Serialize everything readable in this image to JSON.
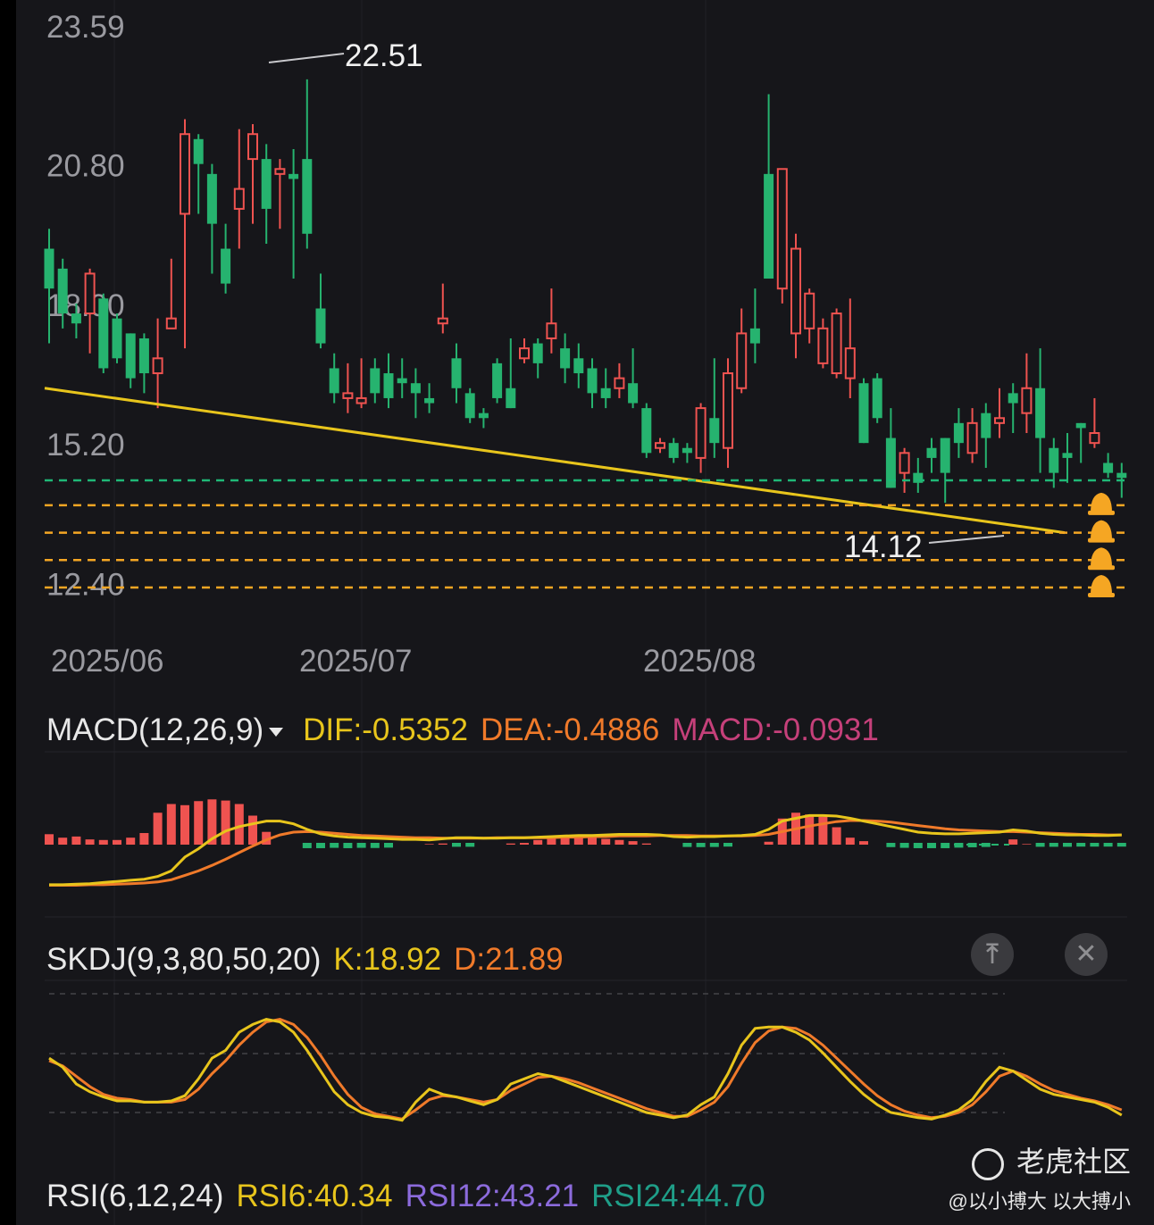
{
  "chart_data": [
    {
      "type": "candlestick",
      "price_ticks": [
        "23.59",
        "20.80",
        "18.00",
        "15.20",
        "12.40"
      ],
      "date_ticks": [
        "2025/06",
        "2025/07",
        "2025/08"
      ],
      "annotations": {
        "high": "22.51",
        "low": "14.12"
      },
      "colors": {
        "up": "#ef5350",
        "down": "#26b36f",
        "trendline": "#e8c51c",
        "support": "#1fb877",
        "alert": "#f5a623"
      },
      "candles": [
        [
          19.1,
          18.3,
          19.5,
          17.2
        ],
        [
          18.7,
          17.8,
          18.9,
          17.5
        ],
        [
          17.8,
          17.6,
          18.0,
          17.3
        ],
        [
          17.8,
          18.6,
          18.7,
          17.0
        ],
        [
          18.1,
          16.7,
          18.2,
          16.6
        ],
        [
          17.7,
          16.9,
          17.8,
          16.8
        ],
        [
          17.4,
          16.5,
          17.4,
          16.3
        ],
        [
          17.3,
          16.6,
          17.4,
          16.2
        ],
        [
          16.6,
          16.9,
          17.7,
          15.9
        ],
        [
          17.5,
          17.7,
          18.9,
          17.5
        ],
        [
          19.8,
          21.4,
          21.7,
          17.1
        ],
        [
          21.3,
          20.8,
          21.4,
          19.8
        ],
        [
          20.6,
          19.6,
          20.8,
          18.6
        ],
        [
          19.1,
          18.4,
          19.6,
          18.2
        ],
        [
          19.9,
          20.3,
          21.5,
          19.1
        ],
        [
          20.9,
          21.4,
          21.6,
          19.6
        ],
        [
          20.9,
          19.9,
          21.2,
          19.2
        ],
        [
          20.6,
          20.7,
          20.9,
          19.5
        ],
        [
          20.6,
          20.5,
          21.1,
          18.5
        ],
        [
          20.9,
          19.4,
          22.5,
          19.1
        ],
        [
          17.9,
          17.2,
          18.6,
          17.1
        ],
        [
          16.7,
          16.2,
          17.0,
          16.0
        ],
        [
          16.1,
          16.2,
          16.8,
          15.8
        ],
        [
          16.0,
          16.1,
          16.9,
          15.9
        ],
        [
          16.7,
          16.2,
          16.9,
          16.0
        ],
        [
          16.6,
          16.1,
          17.0,
          15.9
        ],
        [
          16.5,
          16.4,
          16.9,
          16.1
        ],
        [
          16.4,
          16.2,
          16.7,
          15.7
        ],
        [
          16.1,
          16.0,
          16.4,
          15.8
        ],
        [
          17.6,
          17.7,
          18.4,
          17.4
        ],
        [
          16.9,
          16.3,
          17.2,
          16.0
        ],
        [
          16.2,
          15.7,
          16.3,
          15.6
        ],
        [
          15.8,
          15.7,
          15.9,
          15.5
        ],
        [
          16.8,
          16.1,
          16.9,
          16.0
        ],
        [
          16.3,
          15.9,
          17.3,
          15.9
        ],
        [
          16.9,
          17.1,
          17.3,
          16.8
        ],
        [
          17.2,
          16.8,
          17.3,
          16.5
        ],
        [
          17.3,
          17.6,
          18.3,
          17.0
        ],
        [
          17.1,
          16.7,
          17.4,
          16.4
        ],
        [
          16.9,
          16.6,
          17.2,
          16.3
        ],
        [
          16.7,
          16.2,
          16.9,
          15.9
        ],
        [
          16.3,
          16.1,
          16.7,
          15.9
        ],
        [
          16.3,
          16.5,
          16.8,
          16.1
        ],
        [
          16.4,
          16.0,
          17.1,
          15.9
        ],
        [
          15.9,
          15.0,
          16.0,
          14.9
        ],
        [
          15.1,
          15.2,
          15.3,
          15.0
        ],
        [
          15.2,
          14.9,
          15.3,
          14.8
        ],
        [
          15.1,
          15.0,
          15.2,
          14.8
        ],
        [
          14.9,
          15.9,
          16.0,
          14.6
        ],
        [
          15.7,
          15.2,
          16.9,
          14.9
        ],
        [
          15.1,
          16.6,
          16.9,
          14.7
        ],
        [
          16.3,
          17.4,
          17.9,
          16.2
        ],
        [
          17.5,
          17.2,
          18.3,
          16.8
        ],
        [
          20.6,
          18.5,
          22.2,
          18.5
        ],
        [
          18.3,
          20.7,
          20.7,
          18.0
        ],
        [
          17.4,
          19.1,
          19.4,
          16.9
        ],
        [
          17.5,
          18.2,
          18.3,
          17.2
        ],
        [
          16.8,
          17.5,
          17.7,
          16.7
        ],
        [
          16.6,
          17.8,
          17.9,
          16.5
        ],
        [
          16.5,
          17.1,
          18.1,
          16.1
        ],
        [
          16.4,
          15.2,
          16.5,
          15.2
        ],
        [
          16.5,
          15.7,
          16.6,
          15.6
        ],
        [
          15.3,
          14.3,
          15.9,
          14.3
        ],
        [
          14.6,
          15.0,
          15.1,
          14.2
        ],
        [
          14.6,
          14.4,
          14.9,
          14.2
        ],
        [
          15.1,
          14.9,
          15.3,
          14.6
        ],
        [
          15.3,
          14.6,
          15.3,
          14.0
        ],
        [
          15.6,
          15.2,
          15.9,
          14.9
        ],
        [
          15.0,
          15.6,
          15.9,
          14.8
        ],
        [
          15.8,
          15.3,
          16.0,
          14.7
        ],
        [
          15.6,
          15.7,
          16.3,
          15.3
        ],
        [
          16.2,
          16.0,
          16.4,
          15.4
        ],
        [
          15.8,
          16.3,
          17.0,
          15.4
        ],
        [
          16.3,
          15.3,
          17.1,
          14.6
        ],
        [
          15.1,
          14.6,
          15.3,
          14.3
        ],
        [
          15.0,
          14.9,
          15.4,
          14.4
        ],
        [
          15.6,
          15.5,
          15.6,
          14.8
        ],
        [
          15.2,
          15.4,
          16.1,
          15.1
        ],
        [
          14.8,
          14.6,
          15.0,
          14.5
        ],
        [
          14.6,
          14.5,
          14.8,
          14.1
        ]
      ],
      "trendline": [
        [
          0,
          16.3
        ],
        [
          73,
          13.4
        ]
      ],
      "support_lines": [
        14.45
      ],
      "alert_lines": [
        13.95,
        13.4,
        12.85,
        12.3
      ]
    },
    {
      "type": "bar+line",
      "indicator": "MACD",
      "dif": [
        -0.95,
        -0.95,
        -0.94,
        -0.93,
        -0.91,
        -0.89,
        -0.87,
        -0.85,
        -0.8,
        -0.7,
        -0.45,
        -0.3,
        -0.12,
        0.02,
        0.1,
        0.15,
        0.2,
        0.2,
        0.15,
        0.05,
        -0.03,
        -0.07,
        -0.09,
        -0.1,
        -0.11,
        -0.12,
        -0.13,
        -0.13,
        -0.14,
        -0.12,
        -0.1,
        -0.1,
        -0.11,
        -0.11,
        -0.1,
        -0.1,
        -0.09,
        -0.08,
        -0.07,
        -0.06,
        -0.06,
        -0.05,
        -0.04,
        -0.04,
        -0.04,
        -0.05,
        -0.08,
        -0.09,
        -0.08,
        -0.08,
        -0.07,
        -0.06,
        -0.04,
        0.05,
        0.2,
        0.25,
        0.3,
        0.3,
        0.29,
        0.25,
        0.2,
        0.15,
        0.1,
        0.05,
        0,
        -0.02,
        -0.03,
        -0.03,
        -0.02,
        -0.01,
        0.0,
        0.04,
        0.02,
        -0.02,
        -0.04,
        -0.05,
        -0.05,
        -0.06,
        -0.06,
        -0.05
      ],
      "dea": [
        -0.96,
        -0.96,
        -0.96,
        -0.95,
        -0.95,
        -0.94,
        -0.93,
        -0.92,
        -0.9,
        -0.86,
        -0.78,
        -0.7,
        -0.6,
        -0.49,
        -0.37,
        -0.25,
        -0.14,
        -0.05,
        0.0,
        0.01,
        0.0,
        -0.02,
        -0.04,
        -0.06,
        -0.07,
        -0.08,
        -0.09,
        -0.1,
        -0.1,
        -0.11,
        -0.11,
        -0.11,
        -0.11,
        -0.1,
        -0.1,
        -0.1,
        -0.1,
        -0.1,
        -0.09,
        -0.09,
        -0.08,
        -0.08,
        -0.07,
        -0.07,
        -0.07,
        -0.06,
        -0.06,
        -0.06,
        -0.07,
        -0.07,
        -0.07,
        -0.07,
        -0.06,
        -0.04,
        0.01,
        0.06,
        0.11,
        0.15,
        0.19,
        0.21,
        0.21,
        0.2,
        0.18,
        0.15,
        0.12,
        0.09,
        0.06,
        0.04,
        0.03,
        0.02,
        0.01,
        0.01,
        0.0,
        -0.01,
        -0.02,
        -0.03,
        -0.04,
        -0.04,
        -0.05,
        -0.05
      ],
      "hist": [
        0.18,
        0.12,
        0.14,
        0.09,
        0.08,
        0.08,
        0.12,
        0.2,
        0.55,
        0.7,
        0.68,
        0.75,
        0.78,
        0.76,
        0.7,
        0.5,
        0.22,
        0,
        0,
        -0.1,
        -0.1,
        -0.08,
        -0.1,
        -0.08,
        -0.09,
        -0.07,
        0.0,
        0.0,
        0.01,
        0.02,
        -0.02,
        -0.02,
        0.0,
        0.0,
        0.02,
        0.03,
        0.08,
        0.14,
        0.15,
        0.13,
        0.12,
        0.1,
        0.08,
        0.06,
        0.02,
        0.0,
        0.0,
        -0.03,
        -0.04,
        -0.03,
        -0.01,
        0.0,
        0.0,
        0.05,
        0.45,
        0.55,
        0.52,
        0.48,
        0.3,
        0.12,
        0.06,
        0.0,
        -0.04,
        -0.08,
        -0.1,
        -0.1,
        -0.1,
        -0.07,
        -0.05,
        -0.03,
        0.0,
        0.09,
        0.01,
        -0.02,
        -0.02,
        -0.02,
        -0.01,
        -0.01,
        -0.01,
        -0.01
      ],
      "labels": {
        "name": "MACD(12,26,9)",
        "dif": "DIF:-0.5352",
        "dea": "DEA:-0.4886",
        "macd": "MACD:-0.0931"
      },
      "colors": {
        "dif": "#e8c51c",
        "dea": "#f07a2a",
        "macd_label": "#c5407a",
        "up": "#ef5350",
        "down": "#26b36f"
      }
    },
    {
      "type": "line",
      "indicator": "SKDJ",
      "k": [
        62,
        55,
        42,
        36,
        32,
        29,
        29,
        28,
        28,
        29,
        33,
        46,
        62,
        68,
        82,
        88,
        92,
        90,
        82,
        68,
        52,
        36,
        26,
        20,
        17,
        16,
        14,
        28,
        38,
        34,
        32,
        29,
        26,
        30,
        42,
        46,
        50,
        48,
        44,
        40,
        36,
        32,
        28,
        24,
        20,
        18,
        16,
        18,
        26,
        32,
        50,
        72,
        85,
        86,
        86,
        82,
        76,
        66,
        55,
        44,
        34,
        26,
        20,
        18,
        16,
        15,
        18,
        22,
        30,
        44,
        55,
        52,
        45,
        38,
        34,
        32,
        30,
        28,
        24,
        18
      ],
      "d": [
        60,
        56,
        48,
        40,
        34,
        31,
        30,
        28,
        28,
        28,
        30,
        38,
        50,
        60,
        72,
        82,
        90,
        92,
        88,
        78,
        64,
        48,
        34,
        24,
        19,
        17,
        15,
        22,
        30,
        33,
        32,
        30,
        28,
        30,
        37,
        42,
        47,
        48,
        46,
        43,
        39,
        35,
        31,
        27,
        23,
        20,
        17,
        17,
        22,
        28,
        40,
        58,
        74,
        83,
        86,
        85,
        80,
        72,
        62,
        52,
        42,
        33,
        26,
        21,
        18,
        16,
        17,
        20,
        26,
        36,
        48,
        52,
        48,
        42,
        37,
        34,
        31,
        29,
        26,
        22
      ],
      "ylim": [
        0,
        100
      ],
      "labels": {
        "name": "SKDJ(9,3,80,50,20)",
        "k": "K:18.92",
        "d": "D:21.89"
      },
      "colors": {
        "k": "#e8c51c",
        "d": "#f07a2a"
      }
    },
    {
      "type": "line",
      "indicator": "RSI",
      "labels": {
        "name": "RSI(6,12,24)",
        "rsi6": "RSI6:40.34",
        "rsi12": "RSI12:43.21",
        "rsi24": "RSI24:44.70"
      },
      "colors": {
        "rsi6": "#e8c51c",
        "rsi12": "#8c6bdc",
        "rsi24": "#1f9e88"
      }
    }
  ],
  "controls": {
    "pin_glyph": "⤒",
    "close_glyph": "✕"
  },
  "watermark": {
    "brand": "老虎社区",
    "user": "@以小搏大 以大搏小"
  }
}
